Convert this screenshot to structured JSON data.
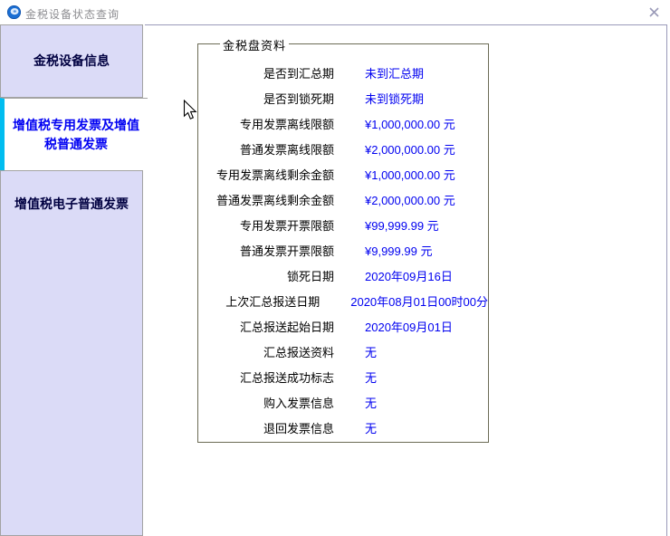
{
  "window": {
    "title": "金税设备状态查询"
  },
  "sidebar": {
    "tabs": [
      {
        "label": "金税设备信息",
        "active": false
      },
      {
        "label": "增值税专用发票及增值税普通发票",
        "active": true
      },
      {
        "label": "增值税电子普通发票",
        "active": false
      }
    ]
  },
  "panel": {
    "legend": "金税盘资料",
    "rows": [
      {
        "label": "是否到汇总期",
        "value": "未到汇总期"
      },
      {
        "label": "是否到锁死期",
        "value": "未到锁死期"
      },
      {
        "label": "专用发票离线限额",
        "value": "¥1,000,000.00 元"
      },
      {
        "label": "普通发票离线限额",
        "value": "¥2,000,000.00 元"
      },
      {
        "label": "专用发票离线剩余金额",
        "value": "¥1,000,000.00 元"
      },
      {
        "label": "普通发票离线剩余金额",
        "value": "¥2,000,000.00 元"
      },
      {
        "label": "专用发票开票限额",
        "value": "¥99,999.99 元"
      },
      {
        "label": "普通发票开票限额",
        "value": "¥9,999.99 元"
      },
      {
        "label": "锁死日期",
        "value": "2020年09月16日"
      },
      {
        "label": "上次汇总报送日期",
        "value": "2020年08月01日00时00分"
      },
      {
        "label": "汇总报送起始日期",
        "value": "2020年09月01日"
      },
      {
        "label": "汇总报送资料",
        "value": "无"
      },
      {
        "label": "汇总报送成功标志",
        "value": "无"
      },
      {
        "label": "购入发票信息",
        "value": "无"
      },
      {
        "label": "退回发票信息",
        "value": "无"
      }
    ]
  },
  "colors": {
    "accent_cyan": "#00bdf0",
    "value_blue": "#0000f0",
    "active_tab_blue": "#0202f2",
    "sidebar_lavender": "#dbdbf7",
    "panel_border": "#9a9ab9",
    "fieldset_border": "#6b6b55",
    "title_gray": "#8e8e92"
  }
}
